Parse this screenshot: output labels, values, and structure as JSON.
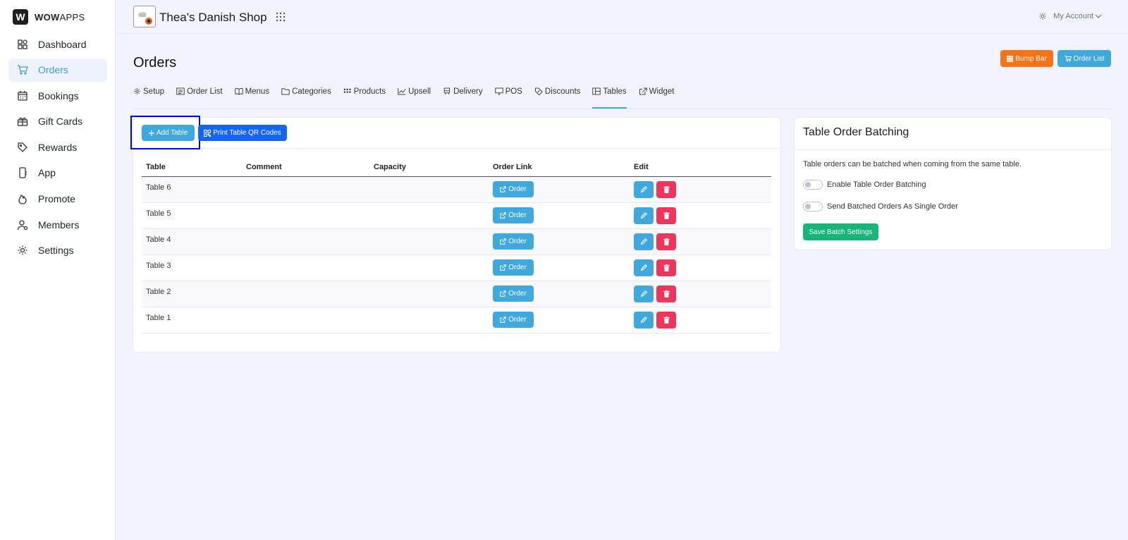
{
  "brand": {
    "mark": "W",
    "name_bold": "WOW",
    "name_rest": "APPS"
  },
  "sidebar": {
    "items": [
      {
        "label": "Dashboard",
        "icon": "dashboard-icon"
      },
      {
        "label": "Orders",
        "icon": "cart-icon",
        "active": true
      },
      {
        "label": "Bookings",
        "icon": "calendar-icon"
      },
      {
        "label": "Gift Cards",
        "icon": "gift-icon"
      },
      {
        "label": "Rewards",
        "icon": "tag-icon"
      },
      {
        "label": "App",
        "icon": "mobile-icon"
      },
      {
        "label": "Promote",
        "icon": "flame-icon"
      },
      {
        "label": "Members",
        "icon": "members-icon"
      },
      {
        "label": "Settings",
        "icon": "gear-icon"
      }
    ]
  },
  "header": {
    "shop_name": "Thea's Danish Shop",
    "account_label": "My Account"
  },
  "page": {
    "title": "Orders",
    "bump_bar_label": "Bump Bar",
    "order_list_label": "Order List"
  },
  "tabs": [
    {
      "label": "Setup",
      "icon": "gear-icon"
    },
    {
      "label": "Order List",
      "icon": "list-icon"
    },
    {
      "label": "Menus",
      "icon": "book-icon"
    },
    {
      "label": "Categories",
      "icon": "folder-icon"
    },
    {
      "label": "Products",
      "icon": "grid-icon"
    },
    {
      "label": "Upsell",
      "icon": "trend-icon"
    },
    {
      "label": "Delivery",
      "icon": "truck-icon"
    },
    {
      "label": "POS",
      "icon": "monitor-icon"
    },
    {
      "label": "Discounts",
      "icon": "discount-icon"
    },
    {
      "label": "Tables",
      "icon": "layout-icon",
      "active": true
    },
    {
      "label": "Widget",
      "icon": "external-icon"
    }
  ],
  "tables_card": {
    "add_label": "Add Table",
    "print_label": "Print Table QR Codes",
    "columns": [
      "Table",
      "Comment",
      "Capacity",
      "Order Link",
      "Edit"
    ],
    "order_label": "Order",
    "rows": [
      {
        "table": "Table 6",
        "comment": "",
        "capacity": ""
      },
      {
        "table": "Table 5",
        "comment": "",
        "capacity": ""
      },
      {
        "table": "Table 4",
        "comment": "",
        "capacity": ""
      },
      {
        "table": "Table 3",
        "comment": "",
        "capacity": ""
      },
      {
        "table": "Table 2",
        "comment": "",
        "capacity": ""
      },
      {
        "table": "Table 1",
        "comment": "",
        "capacity": ""
      }
    ]
  },
  "batching": {
    "title": "Table Order Batching",
    "description": "Table orders can be batched when coming from the same table.",
    "toggle1_label": "Enable Table Order Batching",
    "toggle2_label": "Send Batched Orders As Single Order",
    "save_label": "Save Batch Settings"
  },
  "colors": {
    "accent": "#3fa9dd",
    "orange": "#f97316",
    "blue": "#1565f5",
    "danger": "#f0355b",
    "success": "#16b57a"
  }
}
